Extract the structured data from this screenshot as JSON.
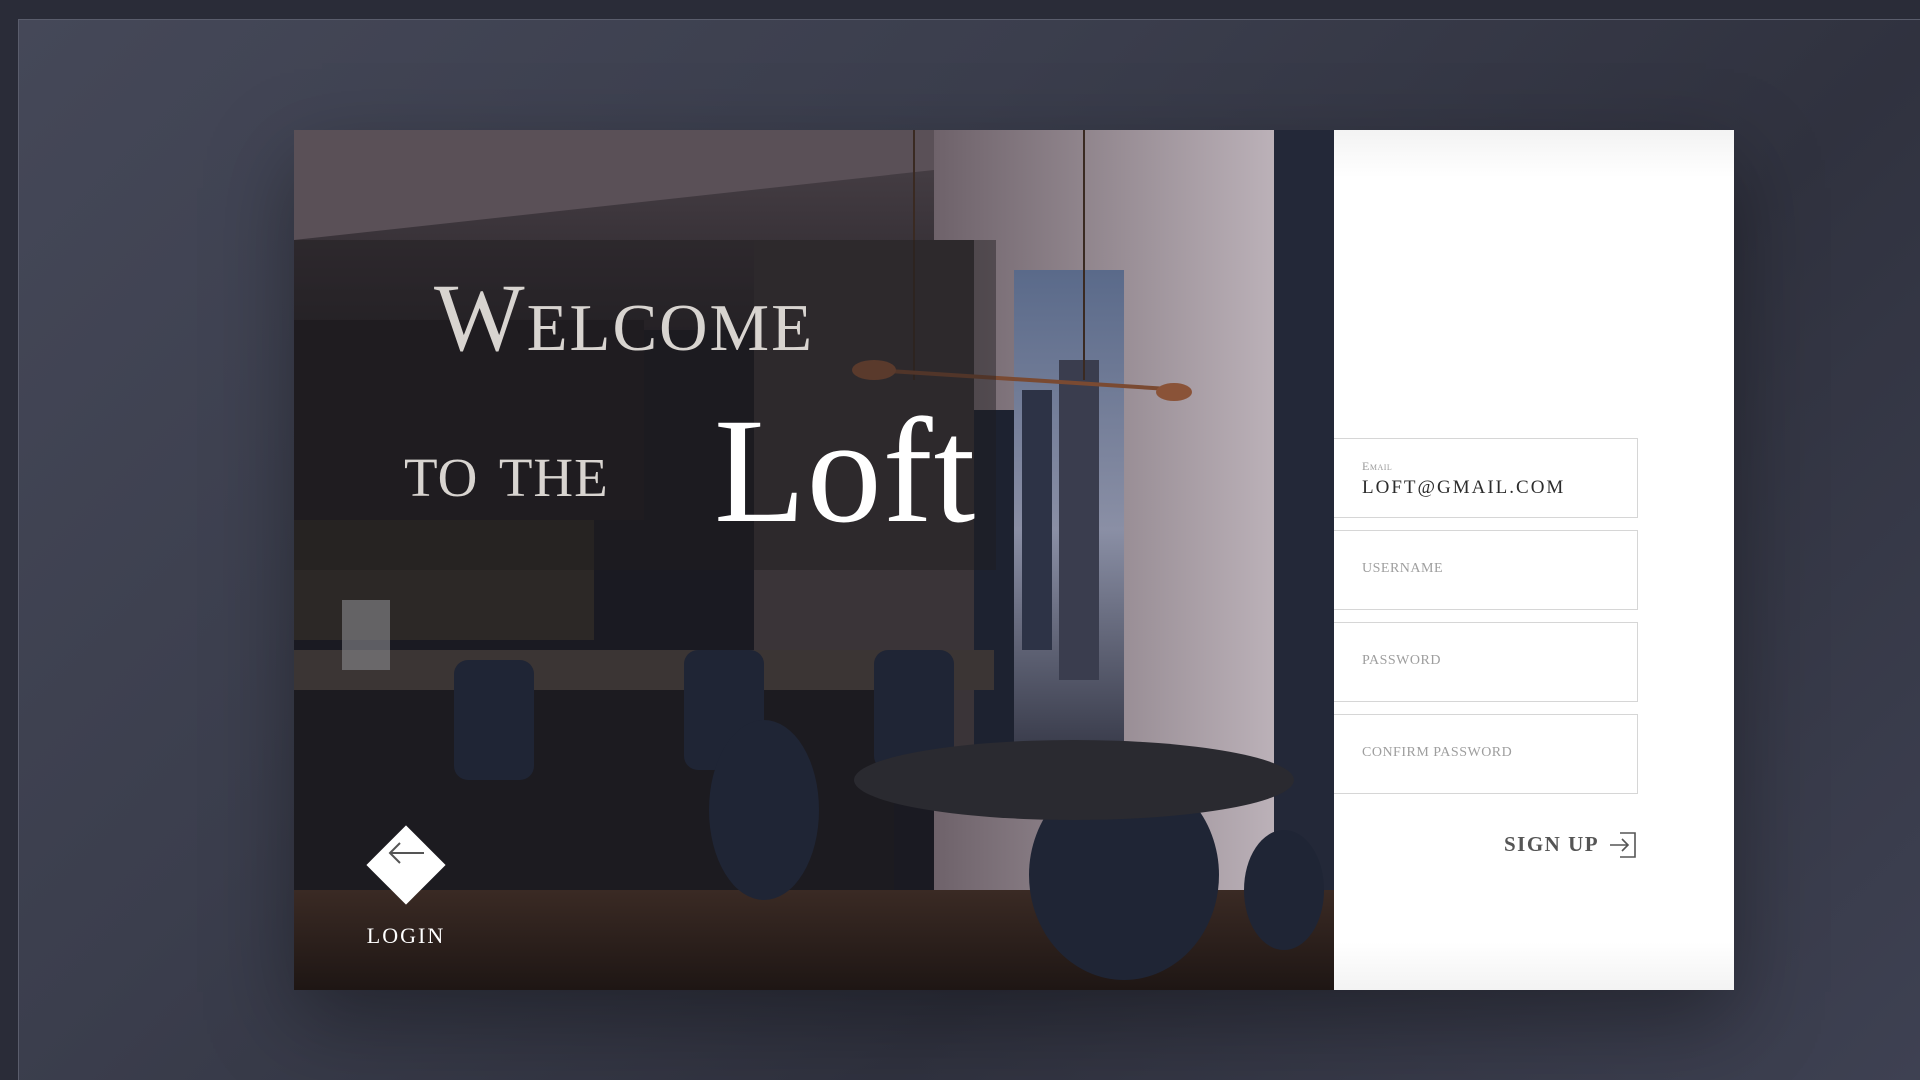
{
  "hero": {
    "line1": "Welcome",
    "line2": "to the",
    "brand": "Loft"
  },
  "login": {
    "label": "LOGIN",
    "icon": "arrow-left-icon"
  },
  "form": {
    "email": {
      "label": "Email",
      "value": "LOFT@GMAIL.COM"
    },
    "username": {
      "placeholder": "USERNAME"
    },
    "password": {
      "placeholder": "PASSWORD"
    },
    "confirm_password": {
      "placeholder": "CONFIRM PASSWORD"
    },
    "submit_label": "SIGN UP",
    "submit_icon": "sign-in-icon"
  },
  "colors": {
    "background": "#3b3e4d",
    "panel": "#ffffff",
    "accent_text": "#d8d4d0"
  }
}
